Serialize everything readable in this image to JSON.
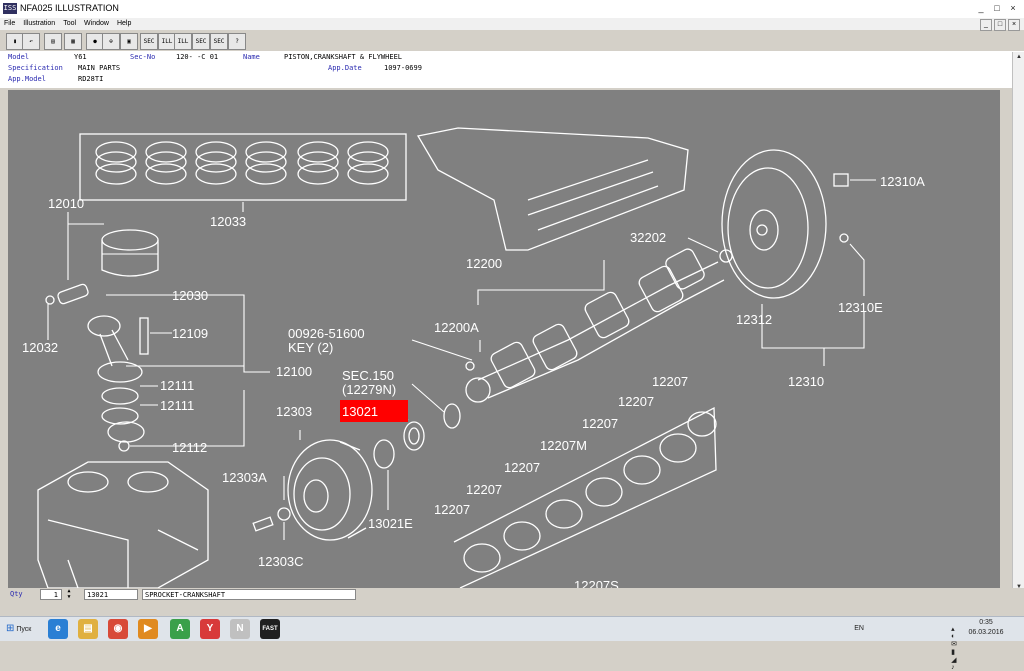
{
  "window": {
    "title": "NFA025 ILLUSTRATION",
    "icon_label": "ISS",
    "controls": [
      "_",
      "□",
      "×"
    ]
  },
  "menu": [
    "File",
    "Illustration",
    "Tool",
    "Window",
    "Help"
  ],
  "mdi_controls": [
    "_",
    "□",
    "×"
  ],
  "toolbar": [
    {
      "name": "book-icon",
      "label": "▮"
    },
    {
      "name": "back-icon",
      "label": "↶"
    },
    {
      "name": "print-icon",
      "label": "▤"
    },
    {
      "name": "grid-icon",
      "label": "▦"
    },
    {
      "name": "circle-icon",
      "label": "●"
    },
    {
      "name": "zoom-icon",
      "label": "⊕"
    },
    {
      "name": "frame-icon",
      "label": "▣"
    },
    {
      "name": "sec-button",
      "label": "SEC"
    },
    {
      "name": "ill-button",
      "label": "ILL"
    },
    {
      "name": "ill-bold-button",
      "label": "ILL"
    },
    {
      "name": "sec2-button",
      "label": "SEC"
    },
    {
      "name": "sec3-button",
      "label": "SEC"
    },
    {
      "name": "help-icon",
      "label": "?"
    }
  ],
  "info": {
    "model_label": "Model",
    "model_value": "Y61",
    "secno_label": "Sec-No",
    "secno_value": "120-  -C 01",
    "name_label": "Name",
    "name_value": "PISTON,CRANKSHAFT & FLYWHEEL",
    "spec_label": "Specification",
    "spec_value": "MAIN PARTS",
    "appdate_label": "App.Date",
    "appdate_value": "1097-0699",
    "appmodel_label": "App.Model",
    "appmodel_value": "RD28TI"
  },
  "diagram_labels": {
    "p12010": "12010",
    "p12033": "12033",
    "p12032": "12032",
    "p12030": "12030",
    "p12109": "12109",
    "p12100": "12100",
    "p12111a": "12111",
    "p12111b": "12111",
    "p12112": "12112",
    "p12200": "12200",
    "p12200a": "12200A",
    "p00926": "00926-51600",
    "key": "KEY (2)",
    "sec150": "SEC.150",
    "p12279n": "(12279N)",
    "p13021": "13021",
    "p12303": "12303",
    "p12303a": "12303A",
    "p12303c": "12303C",
    "p13021e": "13021E",
    "p32202": "32202",
    "p12310a": "12310A",
    "p12312": "12312",
    "p12310e": "12310E",
    "p12310": "12310",
    "p12207a": "12207",
    "p12207b": "12207",
    "p12207c": "12207",
    "p12207m": "12207M",
    "p12207d": "12207",
    "p12207e": "12207",
    "p12207f": "12207",
    "p12207s": "12207S"
  },
  "highlight_color": "#ff0000",
  "bottom": {
    "qty_label": "Qty",
    "qty_value": "1",
    "part_number": "13021",
    "part_name": "SPROCKET-CRANKSHAFT"
  },
  "taskbar": {
    "start_label": "Пуск",
    "apps": [
      {
        "name": "ie-icon",
        "label": "e",
        "color": "#2a7fd4"
      },
      {
        "name": "folder-icon",
        "label": "▤",
        "color": "#e0b040"
      },
      {
        "name": "chrome-icon",
        "label": "◉",
        "color": "#d84a38"
      },
      {
        "name": "player-icon",
        "label": "▶",
        "color": "#e08a20"
      },
      {
        "name": "app-a-icon",
        "label": "A",
        "color": "#3aa04a"
      },
      {
        "name": "yandex-icon",
        "label": "Y",
        "color": "#d83a3a"
      },
      {
        "name": "nissan-icon",
        "label": "N",
        "color": "#c0c0c0"
      },
      {
        "name": "fast-icon",
        "label": "FAST",
        "color": "#202020"
      }
    ],
    "lang": "EN",
    "time": "0:35",
    "date": "06.03.2016"
  }
}
